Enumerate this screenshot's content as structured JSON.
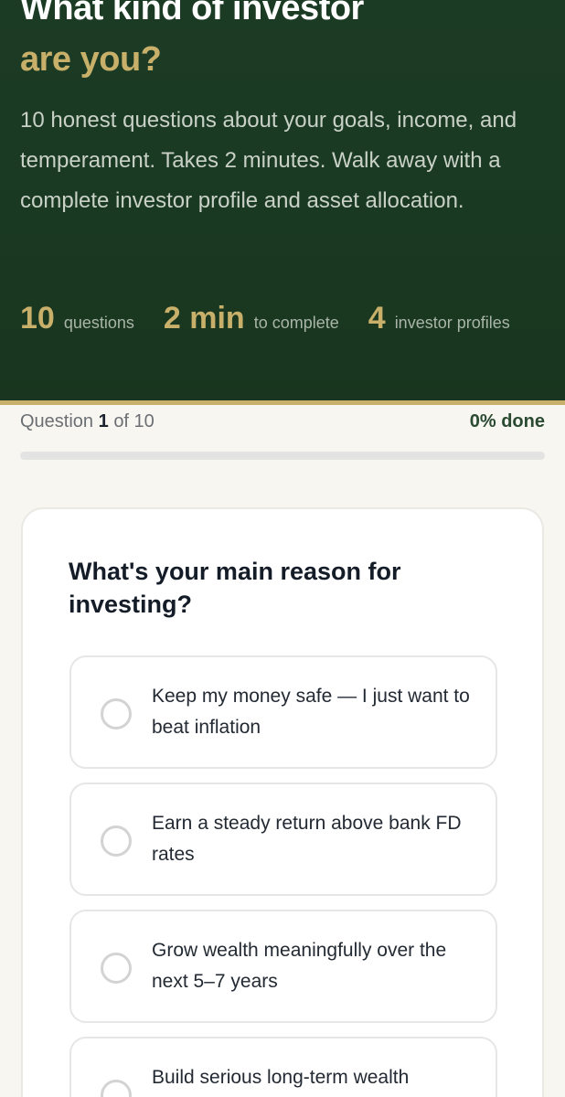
{
  "hero": {
    "title_line1": "What kind of investor",
    "title_line2": "are you?",
    "description": "10 honest questions about your goals, income, and temperament. Takes 2 minutes. Walk away with a complete investor profile and asset allocation.",
    "stats": [
      {
        "value": "10",
        "label": "questions"
      },
      {
        "value": "2 min",
        "label": "to complete"
      },
      {
        "value": "4",
        "label": "investor profiles"
      }
    ],
    "colors": {
      "background": "#1a3922",
      "accent": "#c8b06a"
    }
  },
  "progress": {
    "prefix": "Question",
    "current": "1",
    "suffix": "of 10",
    "percent_label": "0% done",
    "fraction": 0
  },
  "quiz": {
    "question": "What's your main reason for investing?",
    "options": [
      {
        "label": "Keep my money safe — I just want to beat inflation",
        "selected": false
      },
      {
        "label": "Earn a steady return above bank FD rates",
        "selected": false
      },
      {
        "label": "Grow wealth meaningfully over the next 5–7 years",
        "selected": false
      },
      {
        "label": "Build serious long-term wealth",
        "selected": false
      }
    ]
  }
}
